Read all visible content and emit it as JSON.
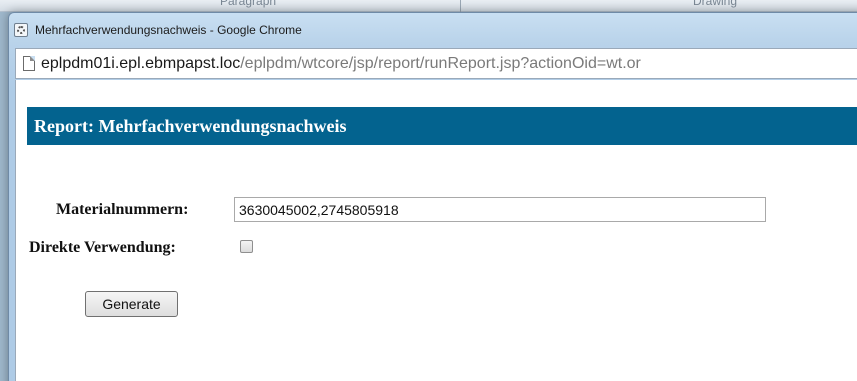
{
  "background_app": {
    "tab_1": "Paragraph",
    "tab_2": "Drawing"
  },
  "window": {
    "title": "Mehrfachverwendungsnachweis - Google Chrome",
    "icon": "chrome-app-icon"
  },
  "address_bar": {
    "icon": "page-icon",
    "host": "eplpdm01i.epl.ebmpapst.loc",
    "path": "/eplpdm/wtcore/jsp/report/runReport.jsp?actionOid=wt.or"
  },
  "report": {
    "title": "Report: Mehrfachverwendungsnachweis",
    "header_color": "#03638f"
  },
  "form": {
    "material_label": "Materialnummern:",
    "material_value": "3630045002,2745805918",
    "direct_label": "Direkte Verwendung:",
    "direct_checked": false,
    "generate_label": "Generate"
  }
}
